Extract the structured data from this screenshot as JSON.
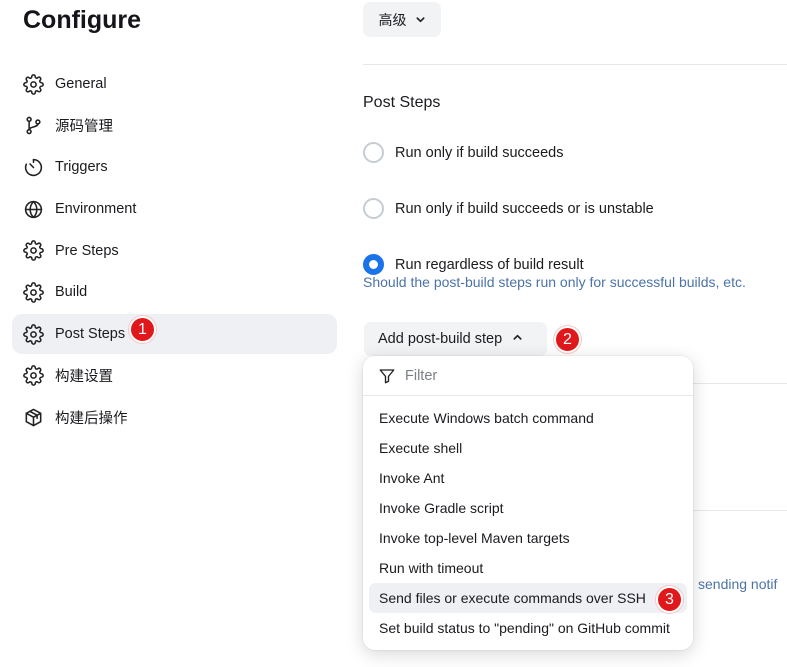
{
  "page": {
    "title": "Configure"
  },
  "sidebar": {
    "items": [
      {
        "label": "General",
        "icon": "gear-icon"
      },
      {
        "label": "源码管理",
        "icon": "source-branch-icon"
      },
      {
        "label": "Triggers",
        "icon": "clock-icon"
      },
      {
        "label": "Environment",
        "icon": "globe-icon"
      },
      {
        "label": "Pre Steps",
        "icon": "gear-icon"
      },
      {
        "label": "Build",
        "icon": "gear-icon"
      },
      {
        "label": "Post Steps",
        "icon": "gear-icon",
        "active": true
      },
      {
        "label": "构建设置",
        "icon": "gear-icon"
      },
      {
        "label": "构建后操作",
        "icon": "package-icon"
      }
    ]
  },
  "advanced": {
    "label": "高级"
  },
  "post_steps": {
    "title": "Post Steps",
    "options": [
      {
        "label": "Run only if build succeeds",
        "checked": false
      },
      {
        "label": "Run only if build succeeds or is unstable",
        "checked": false
      },
      {
        "label": "Run regardless of build result",
        "checked": true
      }
    ],
    "hint": "Should the post-build steps run only for successful builds, etc."
  },
  "add_step": {
    "label": "Add post-build step"
  },
  "dropdown": {
    "filter_placeholder": "Filter",
    "items": [
      "Execute Windows batch command",
      "Execute shell",
      "Invoke Ant",
      "Invoke Gradle script",
      "Invoke top-level Maven targets",
      "Run with timeout",
      "Send files or execute commands over SSH",
      "Set build status to \"pending\" on GitHub commit"
    ],
    "highlighted_index": 6
  },
  "background_text": "sending notif",
  "annotations": {
    "badge1": "1",
    "badge2": "2",
    "badge3": "3"
  },
  "colors": {
    "accent": "#1a73e8",
    "link": "#4c73a8",
    "badge": "#e0181c"
  }
}
